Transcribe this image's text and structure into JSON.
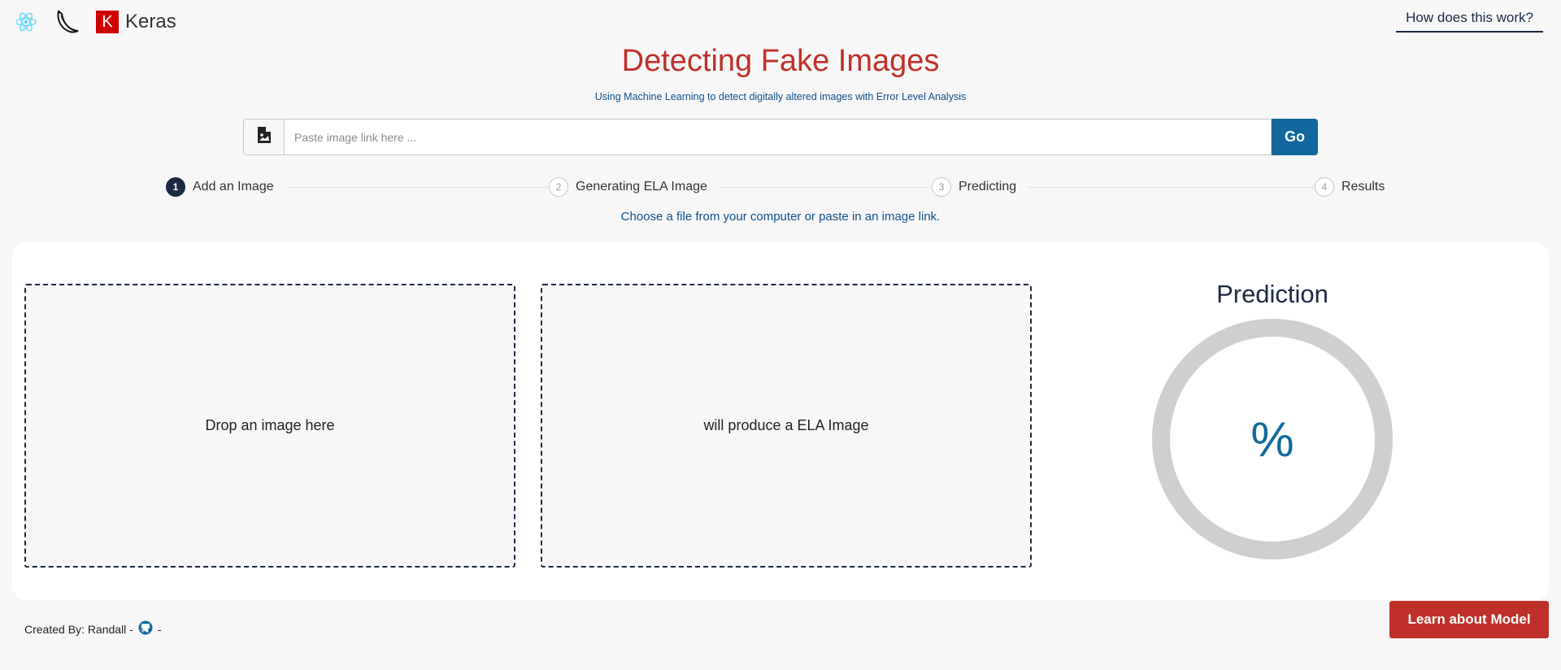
{
  "header": {
    "logos": [
      {
        "icon": "react-logo-icon"
      },
      {
        "icon": "flask-logo-icon"
      },
      {
        "icon": "keras-logo-icon",
        "mark": "K",
        "text": "Keras"
      }
    ],
    "help_link": "How does this work?"
  },
  "hero": {
    "title": "Detecting Fake Images",
    "subtitle": "Using Machine Learning to detect digitally altered images with Error Level Analysis"
  },
  "search": {
    "icon": "image-file-icon",
    "placeholder": "Paste image link here ...",
    "value": "",
    "button_label": "Go"
  },
  "steps": [
    {
      "number": "1",
      "label": "Add an Image",
      "state": "active"
    },
    {
      "number": "2",
      "label": "Generating ELA Image",
      "state": "idle"
    },
    {
      "number": "3",
      "label": "Predicting",
      "state": "idle"
    },
    {
      "number": "4",
      "label": "Results",
      "state": "idle"
    }
  ],
  "hint": "Choose a file from your computer or paste in an image link.",
  "dropzones": {
    "input_label": "Drop an image here",
    "output_label": "will produce a ELA Image"
  },
  "prediction": {
    "title": "Prediction",
    "value_text": "%"
  },
  "footer": {
    "credit_prefix": "Created By: Randall -",
    "github_icon": "github-icon",
    "credit_suffix": "-",
    "learn_button": "Learn about Model"
  },
  "colors": {
    "accent_red": "#c0302a",
    "accent_blue": "#12689e",
    "navy": "#1c2a45",
    "background": "#f7f7f7"
  }
}
